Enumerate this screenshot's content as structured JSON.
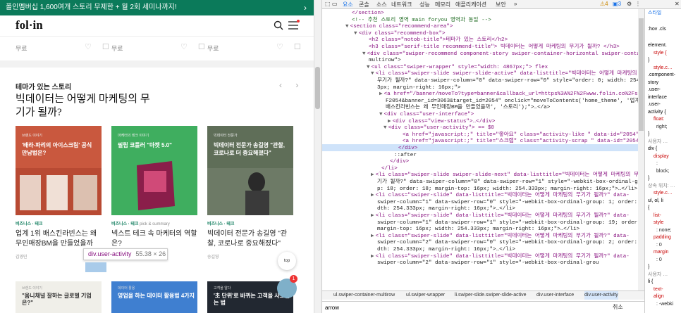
{
  "page": {
    "banner": {
      "text": "폴인멤버십  1,600여개 스토리 무제한 + 월 2회 세미나까지!",
      "arrow": "›"
    },
    "logo": "fol·in",
    "free_labels": [
      "무료",
      "무료",
      "무료"
    ],
    "section_label": "테마가 있는 스토리",
    "pager": "‹ ›",
    "recommend_title": "빅데이터는 어떻게 마케팅의 무기가 될까?",
    "cards": [
      {
        "thumb_tag": "브랜드 이야기",
        "thumb_head": "'배라-파리의 아이스크림' 공식 만남법은?",
        "category": "비즈니스 · 테크",
        "sub": "",
        "title": "업계 1위 배스킨라빈스는 왜 무인매장BM을 만들었을까",
        "author": "김영민",
        "color": "#c9583e"
      },
      {
        "thumb_tag": "마케터의 테크 이야기",
        "thumb_head": "필립 코틀러 \"마켓 5.0\"",
        "category": "비즈니스 · 테크",
        "sub": "pick & summary",
        "title": "넥스트 테크 속 마케터의 역할은?",
        "author": "유수진",
        "color": "#3fae5f"
      },
      {
        "thumb_tag": "빅데이터 전문가",
        "thumb_head": "빅데이터 전문가 송길영 \"관찰, 코로나로 더 중요해졌다\"",
        "category": "비즈니스 · 테크",
        "sub": "",
        "title": "빅데이터 전문가 송길영 \"관찰, 코로나로 중요해졌다\"",
        "author": "송길영",
        "color": "#5f6e58"
      }
    ],
    "tooltip": {
      "name": "div.user-activity",
      "size": "55.38 × 26"
    },
    "top_button": "top",
    "bottom_cards": [
      {
        "tag": "브랜드 이야기",
        "head": "\"옴니채널 잘하는 글로벌 기업은?\"",
        "color": "#f0efe9",
        "text_color": "#333"
      },
      {
        "tag": "데이터 활용",
        "head": "영업을 하는 데이터 활용법 4가지",
        "color": "#3f7fd0",
        "text_color": "#fff"
      },
      {
        "tag": "고객을 알다",
        "head": "'초 단위'로 바뀌는 고객을 사로잡는 법",
        "color": "#222831",
        "text_color": "#fff"
      }
    ],
    "chat_badge": "1"
  },
  "devtools": {
    "tabs": [
      "요소",
      "콘솔",
      "소스",
      "네트워크",
      "성능",
      "메모리",
      "애플리케이션",
      "보안"
    ],
    "badges": {
      "warnings": "4",
      "info": "3"
    },
    "styles_tabs": [
      "스타일",
      ":hov",
      ".cls"
    ],
    "breadcrumbs": [
      "ul.swiper-container-multirow",
      "ul.swiper-wrapper",
      "li.swiper-slide.swiper-slide-active",
      "div.user-interface",
      "div.user-activity"
    ],
    "find_value": "arrow",
    "find_cancel": "취소",
    "dom_lines": [
      "</section>",
      "<!-- 추천 스토리 영역 main foryou 영역과 동일 -->",
      "<section class=\"recommend-area\">",
      "<div class=\"recommend-box\">",
      "<h2 class=\"notob-title\">테마가 있는 스토리</h2>",
      "<h3 class=\"serif-title recommend-title\"> 빅데이터는 어떻게 마케팅의 무기가 될까? </h3>",
      "<div class=\"swiper-recommend component-story swiper-container-horizontal swiper-container-",
      "multirow\">",
      "<ul class=\"swiper-wrapper\" style=\"width: 4867px;\"> flex",
      "<li class=\"swiper-slide swiper-slide-active\" data-listtitle=\"빅데이터는 어떻게 마케팅의",
      "무기가 될까?\" data-swiper-column=\"0\" data-swiper-row=\"0\" style=\"order: 0; width: 254.33",
      "3px; margin-right: 16px;\">",
      "<a href=\"/banner/moveTo?type=banner&callback_url=https%3A%2F%2Fwww.folin.co%2Fstory%2",
      "F2054&banner_id=3063&target_id=2054\" onclick=\"moveToContents('home_theme', '업계 1위",
      "배스킨라빈스는 왜 무인매장BM을 만들었을까', '스토리');\">…</a>",
      "<div class=\"user-interface\">",
      "<div class=\"view-status\">…</div>",
      "<div class=\"user-activity\"> == $0",
      "<a href=\"javascript:;\" title=\"좋아요\" class=\"activity-like \" data-id=\"2054\">…</a>",
      "<a href=\"javascript:;\" title=\"스크랩\" class=\"activity-scrap \" data-id=\"2054\">…</a>",
      "</div>",
      "::after",
      "</div>",
      "</li>",
      "<li class=\"swiper-slide swiper-slide-next\" data-listtitle=\"빅데이터는 어떻게 마케팅의 무",
      "기가 될까?\" data-swiper-column=\"0\" data-swiper-row=\"1\" style=\"-webkit-box-ordinal-grou",
      "p: 18; order: 18; margin-top: 16px; width: 254.333px; margin-right: 16px;\">…</li>",
      "<li class=\"swiper-slide\" data-listtitle=\"빅데이터는 어떻게 마케팅의 무기가 될까?\" data-",
      "swiper-column=\"1\" data-swiper-row=\"0\" style=\"-webkit-box-ordinal-group: 1; order: 1; wi",
      "dth: 254.333px; margin-right: 16px;\">…</li>",
      "<li class=\"swiper-slide\" data-listtitle=\"빅데이터는 어떻게 마케팅의 무기가 될까?\" data-",
      "swiper-column=\"1\" data-swiper-row=\"1\" style=\"-webkit-box-ordinal-group: 19; order: 19;",
      "margin-top: 16px; width: 254.333px; margin-right: 16px;\">…</li>",
      "<li class=\"swiper-slide\" data-listtitle=\"빅데이터는 어떻게 마케팅의 무기가 될까?\" data-",
      "swiper-column=\"2\" data-swiper-row=\"0\" style=\"-webkit-box-ordinal-group: 2; order: 2; wi",
      "dth: 254.333px; margin-right: 16px;\">…</li>",
      "<li class=\"swiper-slide\" data-listtitle=\"빅데이터는 어떻게 마케팅의 무기가 될까?\" data-",
      "swiper-column=\"2\" data-swiper-row=\"1\" style=\"-webkit-box-ordinal-grou"
    ],
    "styles_lines": [
      "element.",
      "style {",
      "}",
      "style.c…",
      ".component-",
      "story",
      ".user-",
      "interface",
      ".user-",
      "activity {",
      "float:",
      "right;",
      "}",
      "사용자 …",
      "div {",
      "display",
      ": ",
      "block;",
      "}",
      "상속 위치: …",
      "style.c…",
      "ul, ol, li",
      "{",
      "list-",
      "style",
      ": none;",
      "padding",
      ": 0",
      "margin",
      ": 0",
      "}",
      "사용자 …",
      "li {",
      "text-",
      "align",
      ": -webki"
    ]
  }
}
